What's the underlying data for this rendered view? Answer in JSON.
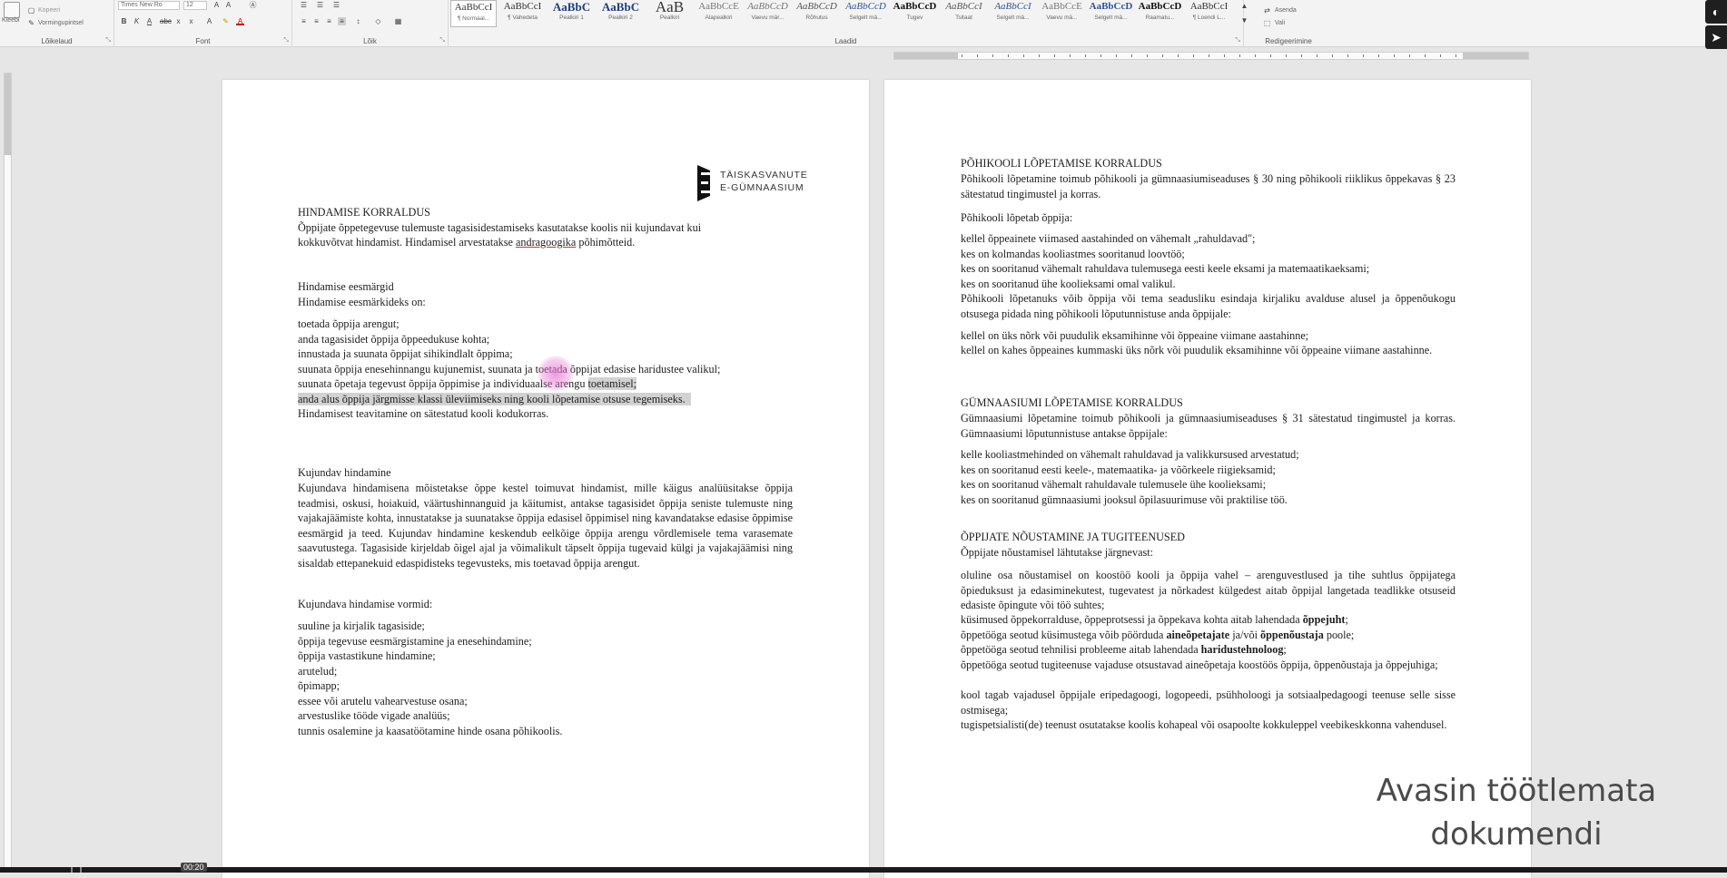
{
  "ribbon": {
    "clipboard": {
      "paste_label": "Kleebi",
      "copy_label": "Kopeeri",
      "format_painter_label": "Vormingupintsel",
      "group_label": "Lõikelaud"
    },
    "font": {
      "font_name": "Times New Ro",
      "font_size": "12",
      "group_label": "Font"
    },
    "paragraph": {
      "group_label": "Lõik"
    },
    "styles": {
      "group_label": "Laadid",
      "items": [
        {
          "sample": "AaBbCcI",
          "name": "¶ Normaal..."
        },
        {
          "sample": "AaBbCcI",
          "name": "¶ Vahedeta"
        },
        {
          "sample": "AaBbC",
          "name": "Pealkiri 1"
        },
        {
          "sample": "AaBbC",
          "name": "Pealkiri 2"
        },
        {
          "sample": "AaB",
          "name": "Pealkiri"
        },
        {
          "sample": "AaBbCcE",
          "name": "Alapealkiri"
        },
        {
          "sample": "AaBbCcD",
          "name": "Vaevu mär..."
        },
        {
          "sample": "AaBbCcD",
          "name": "Rõhutus"
        },
        {
          "sample": "AaBbCcD",
          "name": "Selgelt mä..."
        },
        {
          "sample": "AaBbCcD",
          "name": "Tugev"
        },
        {
          "sample": "AaBbCcI",
          "name": "Tsitaat"
        },
        {
          "sample": "AaBbCcI",
          "name": "Selgelt mä..."
        },
        {
          "sample": "AaBbCcE",
          "name": "Vaevu mä..."
        },
        {
          "sample": "AaBbCcD",
          "name": "Selgelt mä..."
        },
        {
          "sample": "AaBbCcD",
          "name": "Raamatu..."
        },
        {
          "sample": "AaBbCcI",
          "name": "¶ Loendi L..."
        }
      ]
    },
    "editing": {
      "find_label": "Asenda",
      "select_label": "Vali",
      "group_label": "Redigeerimine"
    }
  },
  "page1": {
    "logo_line1": "TÄISKASVANUTE",
    "logo_line2": "E-GÜMNAASIUM",
    "heading_assessment": "HINDAMISE KORRALDUS",
    "intro": [
      "Õppijate õppetegevuse tulemuste tagasisidestamiseks kasutatakse koolis nii kujundavat kui",
      "kokkuvõtvat hindamist. Hindamisel arvestatakse ",
      "andragoogika",
      " põhimõtteid."
    ],
    "goals_title": "Hindamise eesmärgid",
    "goals_intro": "Hindamise eesmärkideks on:",
    "goals": [
      "toetada õppija arengut;",
      "anda tagasisidet õppija õppeedukuse kohta;",
      "innustada ja suunata õppijat sihikindlalt õppima;",
      "suunata õppija enesehinnangu kujunemist, suunata ja toetada õppijat edasise haridustee valikul;",
      "suunata õpetaja tegevust õppija õppimise ja individuaalse arengu ",
      "toetamisel;",
      "anda alus õppija järgmisse klassi üleviimiseks ning kooli lõpetamise otsuse tegemiseks.",
      "Hindamisest teavitamine on sätestatud kooli kodukorras."
    ],
    "formative_title": "Kujundav hindamine",
    "formative_text": "Kujundava hindamisena mõistetakse õppe kestel toimuvat hindamist, mille käigus analüüsitakse õppija teadmisi, oskusi, hoiakuid, väärtushinnanguid ja käitumist, antakse tagasisidet õppija seniste tulemuste ning vajakajäämiste kohta, innustatakse ja suunatakse õppija edasisel õppimisel ning kavandatakse edasise õppimise eesmärgid ja teed. Kujundav hindamine keskendub eelkõige õppija arengu võrdlemisele tema varasemate saavutustega. Tagasiside kirjeldab õigel ajal ja võimalikult täpselt õppija tugevaid külgi ja vajakajäämisi ning sisaldab ettepanekuid edaspidisteks tegevusteks, mis toetavad õppija arengut.",
    "forms_title": "Kujundava hindamise vormid:",
    "forms": [
      "suuline ja kirjalik tagasiside;",
      "õppija tegevuse eesmärgistamine ja enesehindamine;",
      "õppija vastastikune hindamine;",
      "arutelud;",
      "õpimapp;",
      "essee või arutelu vahearvestuse osana;",
      "arvestuslike tööde vigade analüüs;",
      "tunnis osalemine ja kaasatöötamine hinde osana põhikoolis."
    ]
  },
  "page2": {
    "basic_title": "PÕHIKOOLI LÕPETAMISE KORRALDUS",
    "basic_text": "Põhikooli lõpetamine toimub põhikooli ja gümnaasiumiseaduses § 30 ning põhikooli riiklikus õppekavas § 23 sätestatud tingimustel ja korras.",
    "basic_intro": "Põhikooli lõpetab õppija:",
    "basic_items": [
      "kellel õppeainete viimased aastahinded on vähemalt „rahuldavad\";",
      "kes on kolmandas kooliastmes sooritanud loovtöö;",
      "kes on sooritanud vähemalt rahuldava tulemusega eesti keele eksami ja matemaatikaeksami;",
      "kes on sooritanud ühe koolieksami omal valikul."
    ],
    "basic_note": "Põhikooli lõpetanuks võib õppija või tema seadusliku esindaja kirjaliku avalduse alusel ja õppenõukogu otsusega pidada ning põhikooli lõputunnistuse anda õppijale:",
    "basic_extra": [
      "kellel on üks nõrk või puudulik eksamihinne või õppeaine viimane aastahinne;",
      "kellel on kahes õppeaines kummaski üks nõrk või puudulik eksamihinne või õppeaine viimane aastahinne."
    ],
    "gym_title": "GÜMNAASIUMI LÕPETAMISE KORRALDUS",
    "gym_text": "Gümnaasiumi lõpetamine toimub põhikooli ja gümnaasiumiseaduses § 31 sätestatud tingimustel ja korras. Gümnaasiumi lõputunnistuse antakse õppijale:",
    "gym_items": [
      "kelle kooliastmehinded on vähemalt rahuldavad ja valikkursused arvestatud;",
      "kes on sooritanud eesti keele-, matemaatika- ja võõrkeele riigieksamid;",
      "kes on sooritanud vähemalt rahuldavale tulemusele ühe koolieksami;",
      "kes on sooritanud gümnaasiumi jooksul õpilasuurimuse või praktilise töö."
    ],
    "support_title": "ÕPPIJATE NÕUSTAMINE JA TUGITEENUSED",
    "support_intro": "Õppijate nõustamisel lähtutakse järgnevast:",
    "support_1": "oluline osa nõustamisel on koostöö kooli ja õppija vahel – arenguvestlused ja tihe suhtlus õppijatega õpieduksust ja edasiminekutest, tugevatest ja nõrkadest külgedest aitab õppijal langetada teadlikke otsuseid edasiste õpingute või töö suhtes;",
    "support_2a": "küsimused õppekorralduse, õppeprotsessi ja õppekava kohta aitab lahendada ",
    "support_2b": "õppejuht",
    "support_2c": ";",
    "support_3a": "õppetööga seotud küsimustega võib pöörduda ",
    "support_3b": "aineõpetajate",
    "support_3c": " ja/või ",
    "support_3d": "õppenõustaja",
    "support_3e": " poole;",
    "support_4a": "õppetööga seotud tehnilisi probleeme aitab lahendada ",
    "support_4b": "haridustehnoloog",
    "support_4c": ";",
    "support_5": "õppetööga seotud tugiteenuse vajaduse otsustavad aineõpetaja koostöös õppija, õppenõustaja ja õppejuhiga;",
    "support_6": "kool tagab vajadusel õppijale eripedagoogi, logopeedi, psühholoogi ja sotsiaalpedagoogi teenuse selle sisse ostmisega;",
    "support_7": "tugispetsialisti(de) teenust osutatakse koolis kohapeal või osapoolte kokkuleppel veebikeskkonna vahendusel."
  },
  "caption": {
    "line1": "Avasin töötlemata",
    "line2": "dokumendi"
  },
  "video": {
    "time": "00:20"
  },
  "colors": {
    "logo": "#111111",
    "cursor_highlight": "#e678d2",
    "selection": "#d2d2d2"
  },
  "icons": [
    "paste-icon",
    "copy-icon",
    "format-painter-icon",
    "bold-icon",
    "italic-icon",
    "underline-icon",
    "find-icon",
    "send-icon"
  ]
}
